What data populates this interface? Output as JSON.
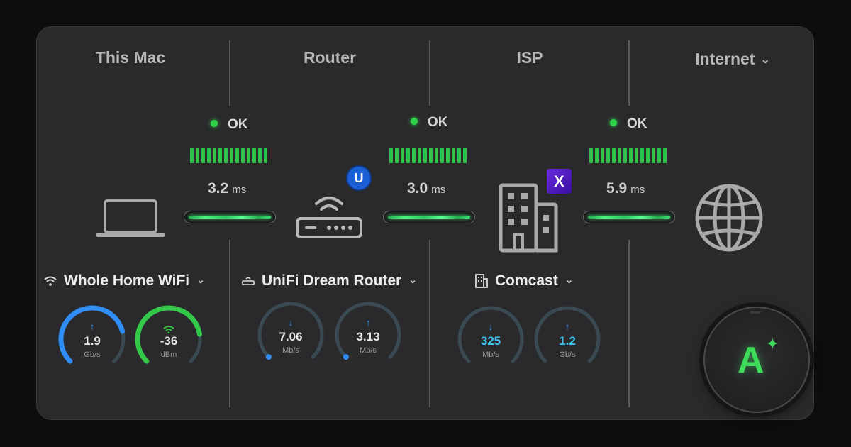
{
  "columns": [
    {
      "title": "This Mac"
    },
    {
      "title": "Router"
    },
    {
      "title": "ISP"
    },
    {
      "title": "Internet",
      "has_dropdown": true
    }
  ],
  "links": [
    {
      "status": "OK",
      "latency_value": "3.2",
      "latency_unit": "ms",
      "bars_filled": 14
    },
    {
      "status": "OK",
      "latency_value": "3.0",
      "latency_unit": "ms",
      "bars_filled": 14
    },
    {
      "status": "OK",
      "latency_value": "5.9",
      "latency_unit": "ms",
      "bars_filled": 14
    }
  ],
  "devices": {
    "mac": {
      "label": "Whole Home WiFi",
      "icon": "wifi-icon"
    },
    "router": {
      "label": "UniFi Dream Router",
      "icon": "router-icon",
      "badge": "U"
    },
    "isp": {
      "label": "Comcast",
      "icon": "building-icon",
      "badge": "X"
    },
    "internet": {
      "icon": "globe-icon"
    }
  },
  "gauges": {
    "mac_speed": {
      "arrow": "↑",
      "value": "1.9",
      "unit": "Gb/s",
      "fraction": 0.78,
      "color": "#2f8df5"
    },
    "mac_signal": {
      "arrow": "wifi",
      "value": "-36",
      "unit": "dBm",
      "fraction": 0.8,
      "color": "#34c84a"
    },
    "router_down": {
      "arrow": "↓",
      "value": "7.06",
      "unit": "Mb/s",
      "fraction": 0.02,
      "color": "#2f8df5"
    },
    "router_up": {
      "arrow": "↑",
      "value": "3.13",
      "unit": "Mb/s",
      "fraction": 0.02,
      "color": "#2f8df5"
    },
    "isp_down": {
      "arrow": "↓",
      "value": "325",
      "unit": "Mb/s",
      "fraction": 0.0,
      "color": "#3ec6f0"
    },
    "isp_up": {
      "arrow": "↑",
      "value": "1.2",
      "unit": "Gb/s",
      "fraction": 0.0,
      "color": "#3ec6f0"
    }
  },
  "assistant": {
    "letter": "A",
    "spark": "✦"
  },
  "colors": {
    "accent_green": "#2fd24a",
    "accent_blue": "#2f8df5",
    "panel": "#2a2a2c"
  }
}
